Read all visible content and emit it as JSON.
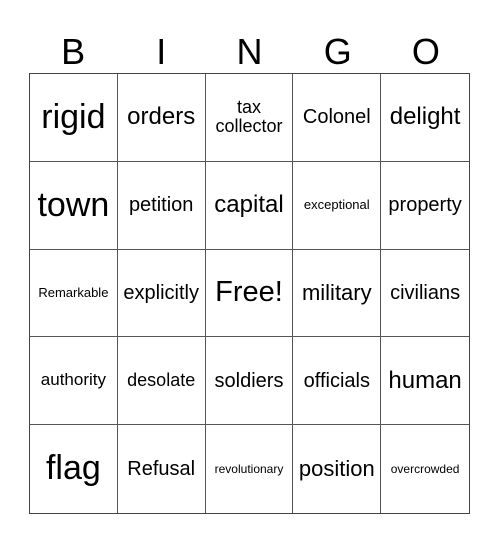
{
  "header": {
    "letters": [
      "B",
      "I",
      "N",
      "G",
      "O"
    ]
  },
  "grid": {
    "cells": [
      "rigid",
      "orders",
      "tax collector",
      "Colonel",
      "delight",
      "town",
      "petition",
      "capital",
      "exceptional",
      "property",
      "Remarkable",
      "explicitly",
      "Free!",
      "military",
      "civilians",
      "authority",
      "desolate",
      "soldiers",
      "officials",
      "human",
      "flag",
      "Refusal",
      "revolutionary",
      "position",
      "overcrowded"
    ],
    "free_space": "Free!"
  }
}
